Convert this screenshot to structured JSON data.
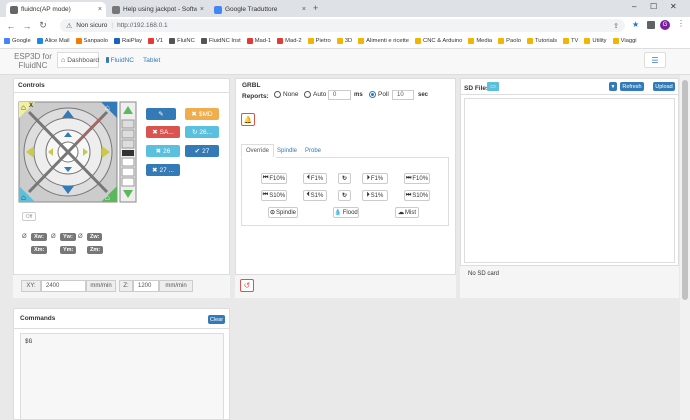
{
  "browser": {
    "tabs": [
      {
        "title": "fluidnc(AP mode)",
        "icon_color": "#555555"
      },
      {
        "title": "Help using jackpot - Software",
        "icon_color": "#555555"
      },
      {
        "title": "Google Traduttore",
        "icon_color": "#4285f4"
      }
    ],
    "new_tab": "+",
    "not_secure": "Non sicuro",
    "url": "http://192.168.0.1",
    "profile_initial": "G",
    "bookmarks": [
      {
        "label": "Google",
        "color": "#4285f4"
      },
      {
        "label": "Alice Mail",
        "color": "#1e88e5"
      },
      {
        "label": "Sanpaolo",
        "color": "#f57c00"
      },
      {
        "label": "RaiPlay",
        "color": "#1565c0"
      },
      {
        "label": "V1",
        "color": "#e53935"
      },
      {
        "label": "FluiNC",
        "color": "#555555"
      },
      {
        "label": "FluidNC Inst",
        "color": "#555555"
      },
      {
        "label": "Mad-1",
        "color": "#e53935"
      },
      {
        "label": "Mad-2",
        "color": "#e53935"
      },
      {
        "label": "Pietro",
        "color": "#f4b400"
      },
      {
        "label": "3D",
        "color": "#f4b400"
      },
      {
        "label": "Alimenti e ricette",
        "color": "#f4b400"
      },
      {
        "label": "CNC & Arduino",
        "color": "#f4b400"
      },
      {
        "label": "Media",
        "color": "#f4b400"
      },
      {
        "label": "Paolo",
        "color": "#f4b400"
      },
      {
        "label": "Tutorials",
        "color": "#f4b400"
      },
      {
        "label": "TV",
        "color": "#f4b400"
      },
      {
        "label": "Utility",
        "color": "#f4b400"
      },
      {
        "label": "Viaggi",
        "color": "#f4b400"
      }
    ]
  },
  "app": {
    "brand": "ESP3D for FluidNC",
    "tabs": [
      "Dashboard",
      "FluidNC",
      "Tablet"
    ]
  },
  "controls": {
    "title": "Controls",
    "jog_axis_label": "X",
    "buttons": {
      "motor_off": "$MD",
      "safety": "SA...",
      "b1": "26...",
      "b2": "26",
      "b3": "27",
      "b4": "27 ..."
    },
    "off_label": "Off",
    "positions": [
      {
        "axis": "Xw:",
        "m": "Xm:"
      },
      {
        "axis": "Yw:",
        "m": "Ym:"
      },
      {
        "axis": "Zw:",
        "m": "Zm:"
      }
    ],
    "feed": {
      "xy_label": "XY:",
      "xy_value": "2400",
      "z_label": "Z:",
      "z_value": "1200",
      "unit": "mm/min"
    }
  },
  "grbl": {
    "title": "GRBL",
    "reports_label": "Reports:",
    "radio_none": "None",
    "radio_auto": "Auto",
    "auto_value": "0",
    "auto_unit": "ms",
    "radio_poll": "Poll",
    "poll_value": "10",
    "poll_unit": "sec",
    "subtabs": [
      "Override",
      "Spindle",
      "Probe"
    ],
    "override_rows": [
      [
        "F10%",
        "F1%",
        "",
        "F1%",
        "F10%"
      ],
      [
        "S10%",
        "S1%",
        "",
        "S1%",
        "S10%"
      ]
    ],
    "toggles": [
      "Spindle",
      "Flood",
      "Mist"
    ]
  },
  "sd": {
    "title": "SD Files",
    "refresh": "Refresh",
    "upload": "Upload",
    "status": "No SD card"
  },
  "commands": {
    "title": "Commands",
    "clear": "Clear",
    "content": "$G"
  }
}
